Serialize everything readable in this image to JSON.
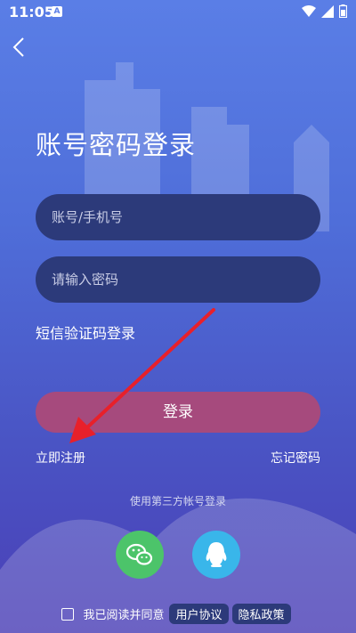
{
  "status_bar": {
    "time": "11:05",
    "indicator": "A",
    "icons": [
      "wifi-icon",
      "signal-icon",
      "battery-icon"
    ]
  },
  "header": {
    "back_icon": "chevron-left-icon"
  },
  "login": {
    "title": "账号密码登录",
    "account_placeholder": "账号/手机号",
    "password_placeholder": "请输入密码",
    "sms_login": "短信验证码登录",
    "login_button": "登录",
    "register": "立即注册",
    "forgot_password": "忘记密码"
  },
  "third_party": {
    "label": "使用第三方帐号登录",
    "wechat_icon": "wechat-icon",
    "qq_icon": "qq-icon"
  },
  "agreement": {
    "text": "我已阅读并同意",
    "user_agreement": "用户协议",
    "privacy_policy": "隐私政策"
  },
  "colors": {
    "accent_button": "#a64a7d",
    "input_bg": "#2c3a7a",
    "wechat": "#4cc46a",
    "qq": "#39b6ea",
    "annotation_arrow": "#e8202a"
  }
}
